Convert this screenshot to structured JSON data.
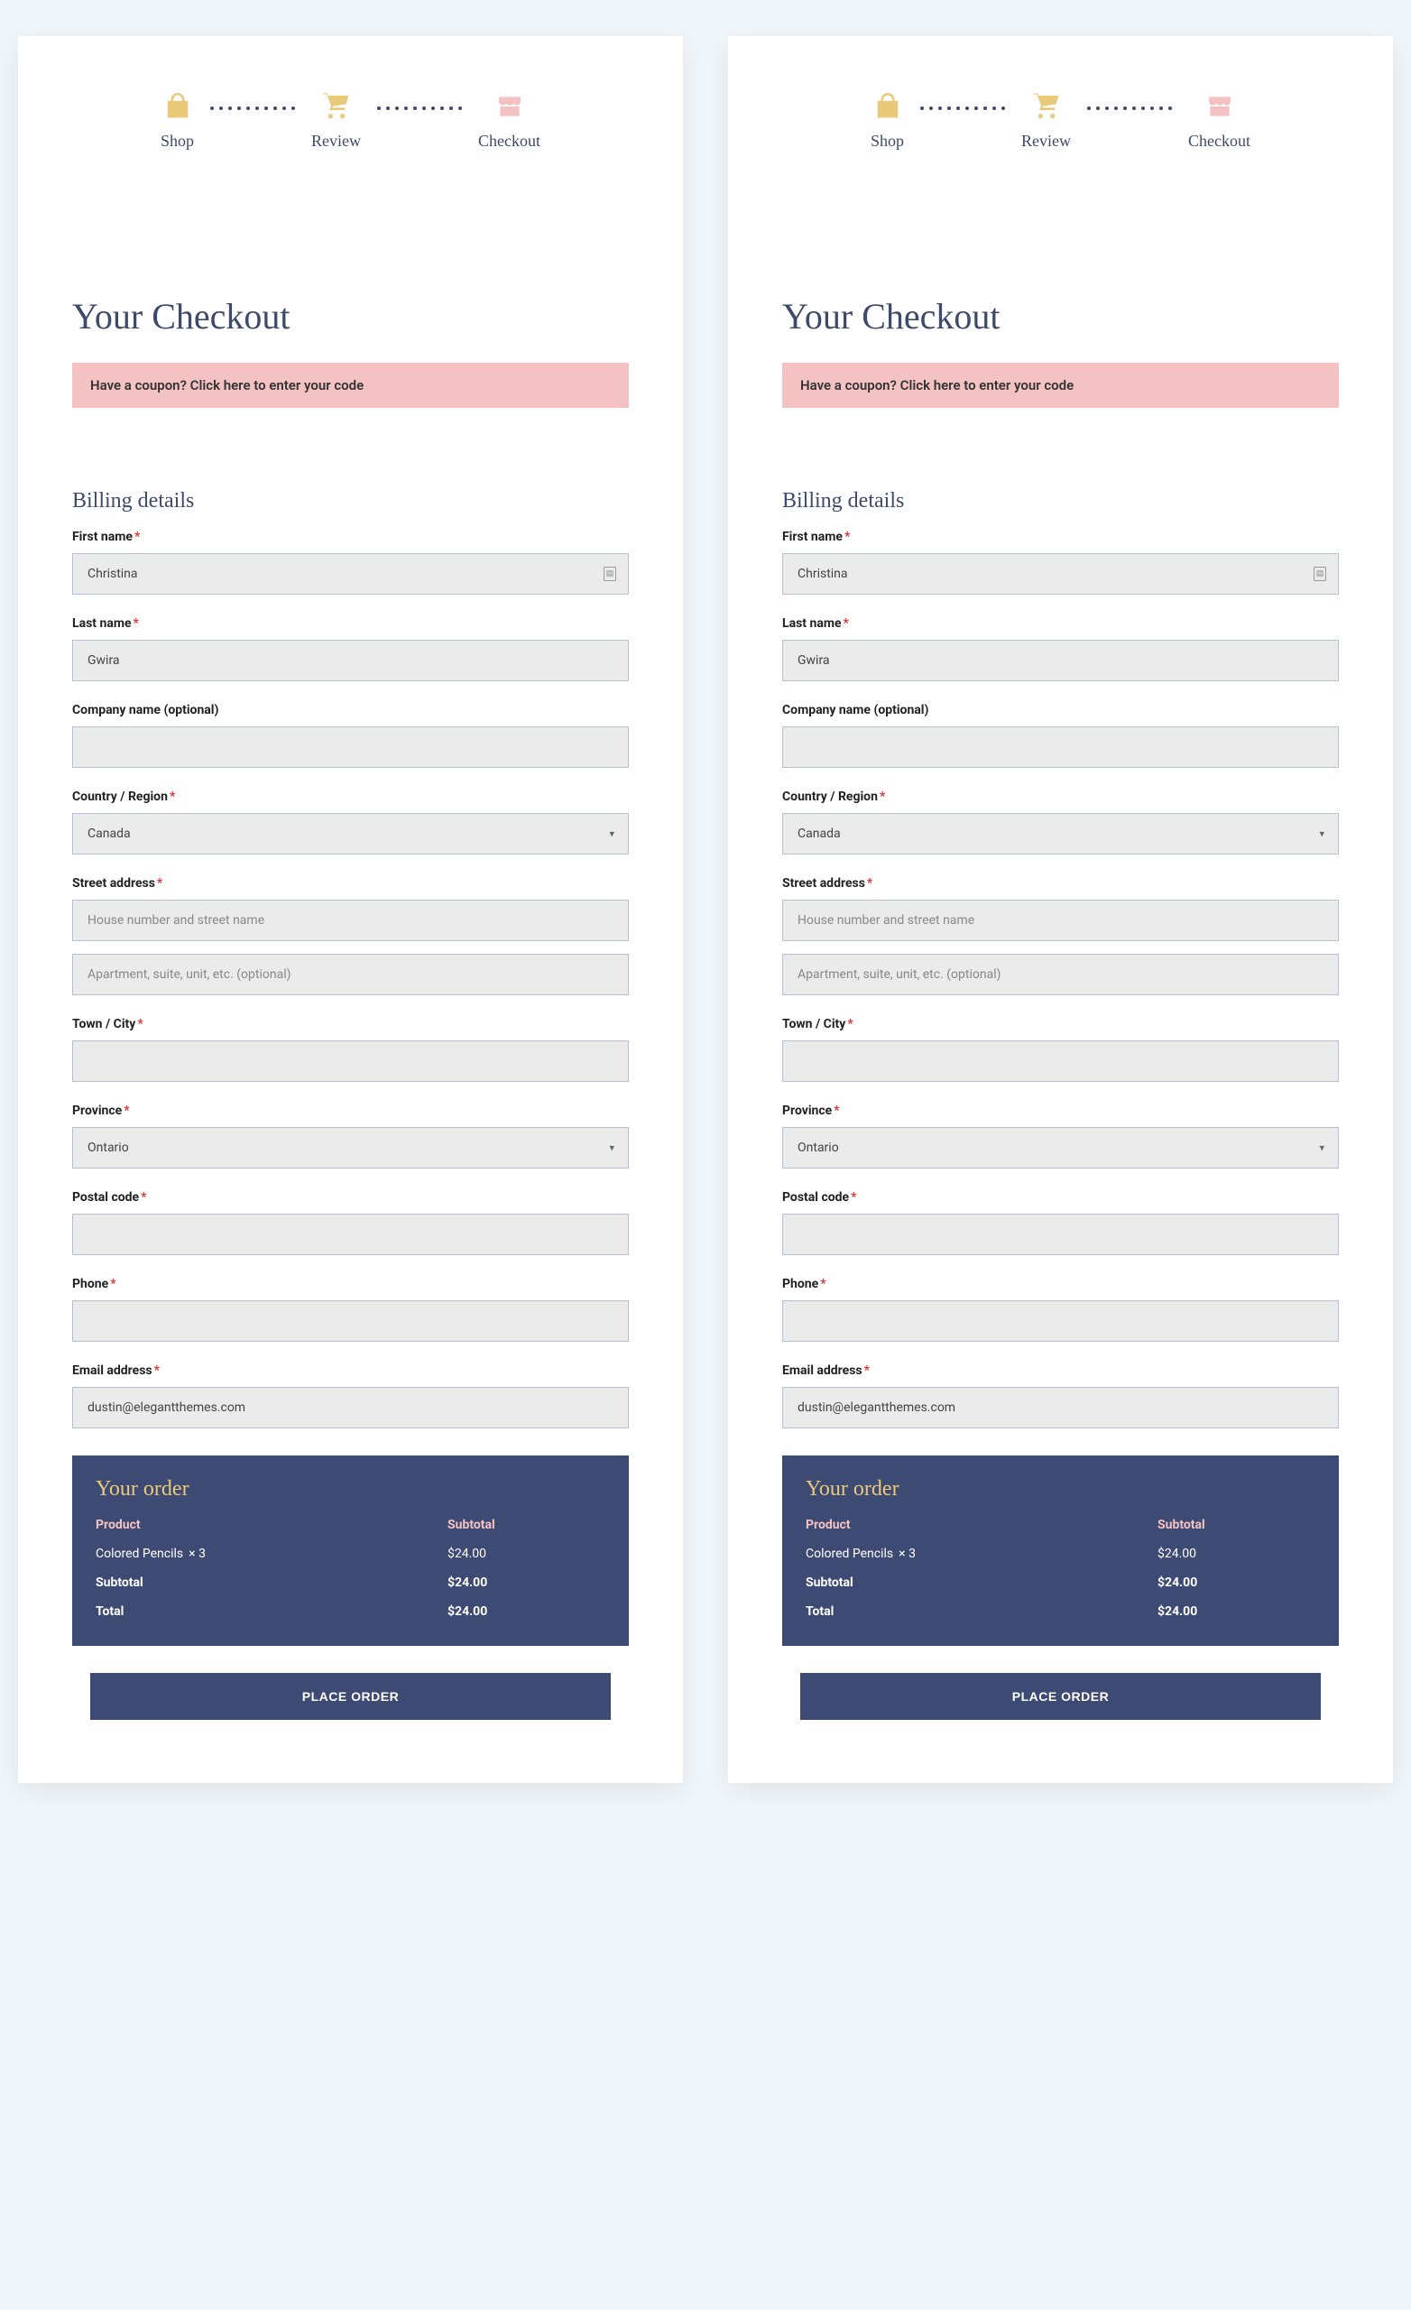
{
  "stepper": {
    "steps": [
      "Shop",
      "Review",
      "Checkout"
    ]
  },
  "page_title": "Your Checkout",
  "coupon": "Have a coupon? Click here to enter your code",
  "billing_title": "Billing details",
  "labels": {
    "first_name": "First name",
    "last_name": "Last name",
    "company": "Company name (optional)",
    "country": "Country / Region",
    "street": "Street address",
    "city": "Town / City",
    "province": "Province",
    "postal": "Postal code",
    "phone": "Phone",
    "email": "Email address"
  },
  "placeholders": {
    "street1": "House number and street name",
    "street2": "Apartment, suite, unit, etc. (optional)"
  },
  "values": {
    "first_name": "Christina",
    "last_name": "Gwira",
    "company": "",
    "country": "Canada",
    "street1": "",
    "street2": "",
    "city": "",
    "province": "Ontario",
    "postal": "",
    "phone": "",
    "email": "dustin@elegantthemes.com"
  },
  "order": {
    "title": "Your order",
    "headers": {
      "product": "Product",
      "subtotal": "Subtotal"
    },
    "item": {
      "name": "Colored Pencils",
      "qty": "× 3",
      "price": "$24.00"
    },
    "subtotal": {
      "label": "Subtotal",
      "value": "$24.00"
    },
    "total": {
      "label": "Total",
      "value": "$24.00"
    }
  },
  "place_order": "PLACE ORDER"
}
